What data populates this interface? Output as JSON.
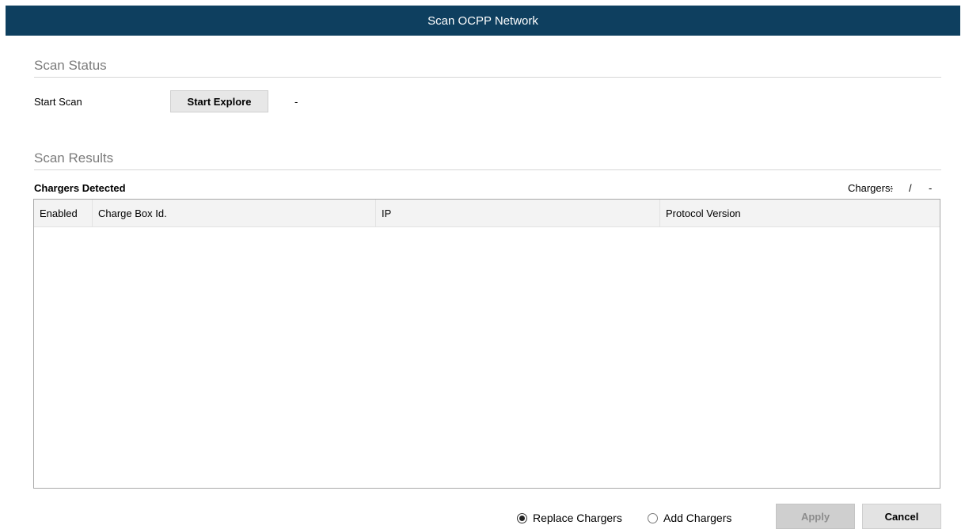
{
  "window": {
    "title": "Scan OCPP Network"
  },
  "scan_status": {
    "heading": "Scan Status",
    "start_scan_label": "Start Scan",
    "start_explore_button": "Start Explore",
    "status_value": "-"
  },
  "scan_results": {
    "heading": "Scan Results",
    "chargers_detected_label": "Chargers Detected",
    "chargers_count_label": "Chargers:",
    "chargers_found": "-",
    "separator": "/",
    "chargers_total": "-",
    "table": {
      "columns": [
        "Enabled",
        "Charge Box Id.",
        "IP",
        "Protocol Version"
      ],
      "rows": []
    }
  },
  "footer": {
    "replace_chargers_label": "Replace Chargers",
    "add_chargers_label": "Add Chargers",
    "selected_mode": "replace",
    "apply_button": "Apply",
    "cancel_button": "Cancel"
  }
}
